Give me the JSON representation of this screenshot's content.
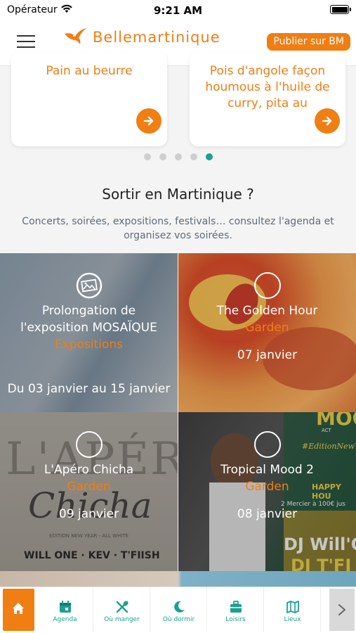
{
  "status_bar": {
    "carrier": "Opérateur",
    "time": "9:21 AM"
  },
  "header": {
    "logo_text": "Bellemartinique",
    "publish_label": "Publier sur BM"
  },
  "recipes": [
    {
      "title": "Pain au beurre"
    },
    {
      "title": "Pois d'angole façon houmous à l'huile de curry, pita au"
    }
  ],
  "carousel": {
    "page_count": 5,
    "active_index": 4
  },
  "section": {
    "title": "Sortir en Martinique ?",
    "description": "Concerts, soirées, expositions, festivals… consultez l'agenda et organisez vos soirées."
  },
  "events": [
    {
      "title": "Prolongation de l'exposition MOSAÏQUE",
      "category": "Expositions",
      "date": "Du 03 janvier au 15 janvier",
      "icon": "gallery-icon"
    },
    {
      "title": "The Golden Hour",
      "category": "Garden",
      "date": "07 janvier",
      "icon": "circle-icon"
    },
    {
      "title": "L'Apéro Chicha",
      "category": "Garden",
      "date": "09 janvier",
      "icon": "circle-icon",
      "poster_texts": [
        "L'APÉRO",
        "Chicha",
        "EDITION NEW YEAR - ALL WHITE",
        "WILL ONE · KEV · T'FIISH"
      ]
    },
    {
      "title": "Tropical Mood 2",
      "category": "Garden",
      "date": "08 janvier",
      "icon": "circle-icon",
      "poster_texts": [
        "MOOD",
        "ACT",
        "#EditionNewYe",
        "HAPPY HOU",
        "2 Mercier à 100€ jus",
        "DJ Will'O",
        "DJ T'FI"
      ]
    }
  ],
  "tabbar": {
    "items": [
      {
        "label": "",
        "icon": "home-icon"
      },
      {
        "label": "Agenda",
        "icon": "calendar-icon"
      },
      {
        "label": "Où manger",
        "icon": "utensils-icon"
      },
      {
        "label": "Où dormir",
        "icon": "moon-icon"
      },
      {
        "label": "Loisirs",
        "icon": "suitcase-icon"
      },
      {
        "label": "Lieux",
        "icon": "map-icon"
      }
    ]
  },
  "colors": {
    "brand_orange": "#f07e13",
    "accent_teal": "#1c9f91"
  }
}
